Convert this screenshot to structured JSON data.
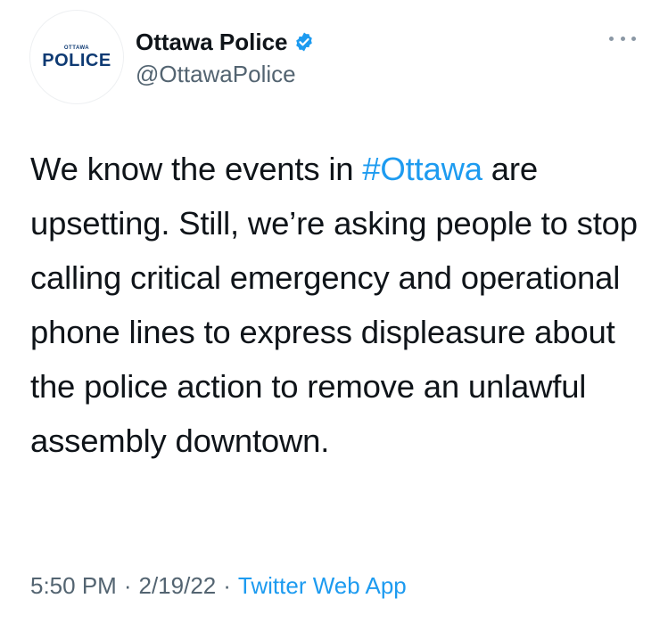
{
  "account": {
    "avatar_text_small": "OTTAWA",
    "avatar_text_big": "POLICE",
    "display_name": "Ottawa Police",
    "handle": "@OttawaPolice",
    "verified": true
  },
  "tweet": {
    "text_before_hashtag": "We know the events in ",
    "hashtag": "#Ottawa",
    "text_after_hashtag": " are upsetting. Still, we’re asking people to stop calling critical emergency and operational phone lines to express displeasure about the police action to remove an unlawful assembly downtown."
  },
  "meta": {
    "time": "5:50 PM",
    "separator": "·",
    "date": "2/19/22",
    "source": "Twitter Web App"
  },
  "colors": {
    "link": "#1d9bf0",
    "secondary_text": "#536471",
    "brand_navy": "#0e3a73"
  }
}
